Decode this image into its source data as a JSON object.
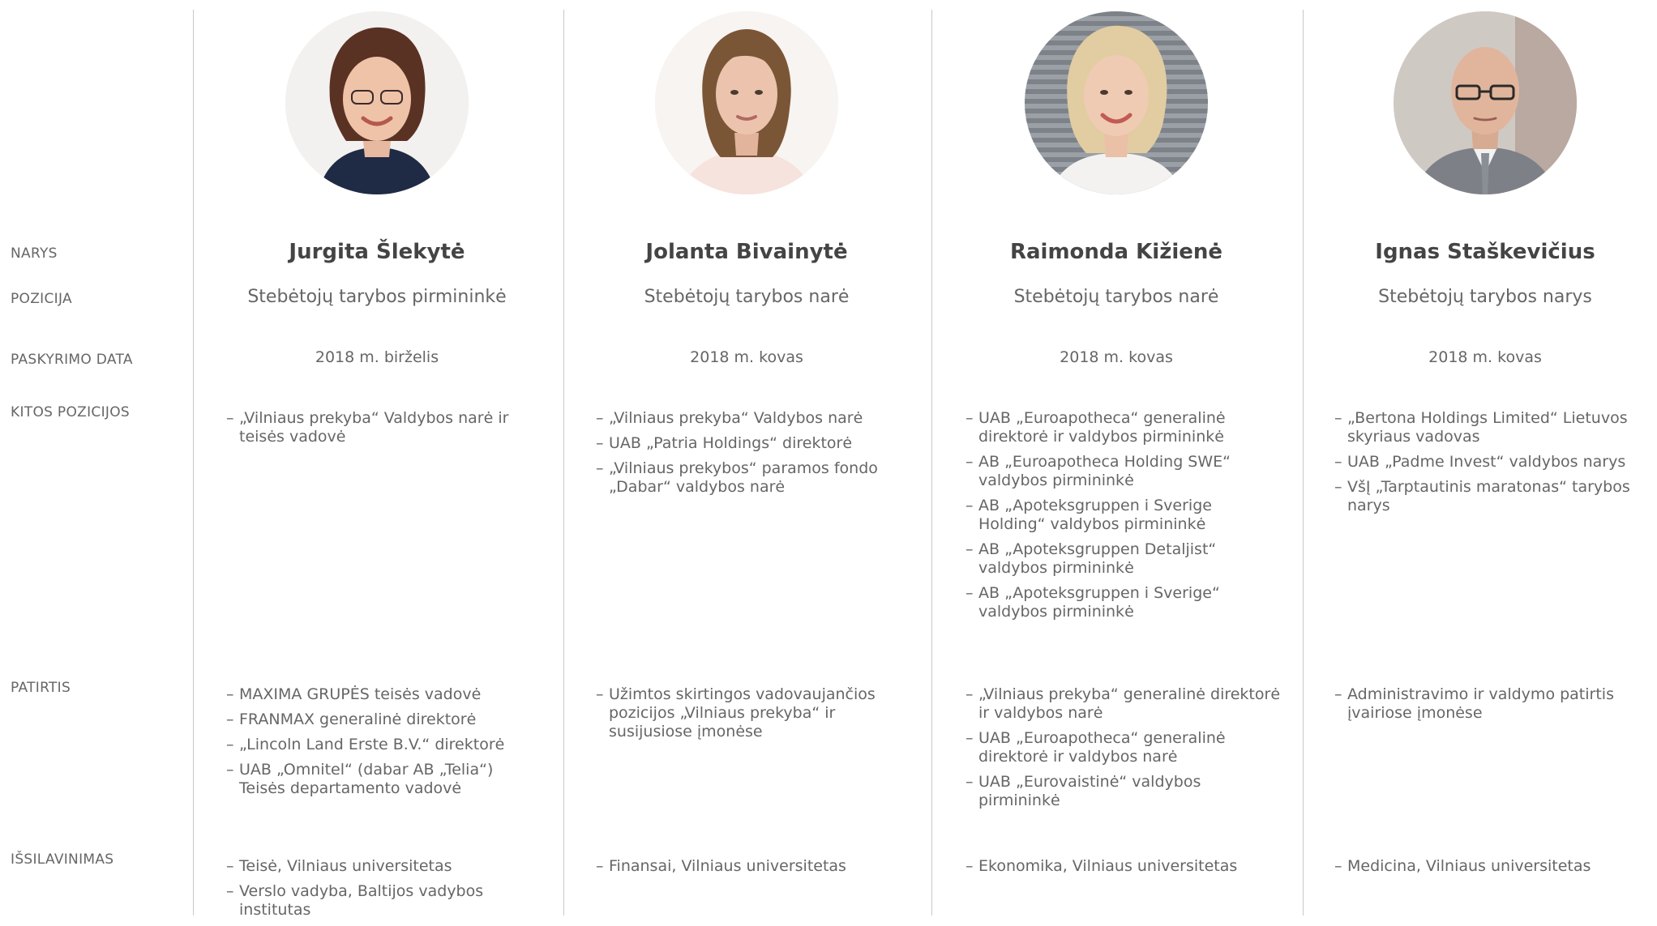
{
  "labels": {
    "member": "NARYS",
    "position": "POZICIJA",
    "appointment_date": "PASKYRIMO DATA",
    "other_positions": "KITOS POZICIJOS",
    "experience": "PATIRTIS",
    "education": "IŠSILAVINIMAS"
  },
  "members": [
    {
      "name": "Jurgita Šlekytė",
      "position": "Stebėtojų tarybos pirmininkė",
      "date": "2018 m. birželis",
      "other_positions": [
        "„Vilniaus prekyba“ Valdybos narė ir teisės vadovė"
      ],
      "experience": [
        "MAXIMA GRUPĖS teisės vadovė",
        "FRANMAX generalinė direktorė",
        "„Lincoln Land Erste B.V.“ direktorė",
        "UAB „Omnitel“ (dabar AB „Telia“) Teisės departamento vadovė"
      ],
      "education": [
        "Teisė, Vilniaus universitetas",
        "Verslo vadyba, Baltijos vadybos institutas"
      ]
    },
    {
      "name": "Jolanta Bivainytė",
      "position": "Stebėtojų tarybos narė",
      "date": "2018 m. kovas",
      "other_positions": [
        "„Vilniaus prekyba“ Valdybos narė",
        "UAB „Patria Holdings“ direktorė",
        "„Vilniaus prekybos“ paramos fondo „Dabar“ valdybos narė"
      ],
      "experience": [
        "Užimtos skirtingos vadovaujančios pozicijos „Vilniaus prekyba“ ir susijusiose įmonėse"
      ],
      "education": [
        "Finansai, Vilniaus universitetas"
      ]
    },
    {
      "name": "Raimonda Kižienė",
      "position": "Stebėtojų tarybos narė",
      "date": "2018 m. kovas",
      "other_positions": [
        "UAB „Euroapotheca“ generalinė direktorė ir valdybos pirmininkė",
        "AB „Euroapotheca Holding SWE“ valdybos pirmininkė",
        "AB „Apoteksgruppen i Sverige Holding“ valdybos pirmininkė",
        "AB „Apoteksgruppen Detaljist“ valdybos pirmininkė",
        "AB „Apoteksgruppen i Sverige“ valdybos pirmininkė"
      ],
      "experience": [
        "„Vilniaus prekyba“ generalinė direktorė ir valdybos narė",
        "UAB „Euroapotheca“ generalinė direktorė ir valdybos narė",
        "UAB „Eurovaistinė“ valdybos pirmininkė"
      ],
      "education": [
        "Ekonomika, Vilniaus universitetas"
      ]
    },
    {
      "name": "Ignas Staškevičius",
      "position": "Stebėtojų tarybos narys",
      "date": "2018 m. kovas",
      "other_positions": [
        "„Bertona Holdings Limited“ Lietuvos skyriaus vadovas",
        "UAB „Padme Invest“ valdybos narys",
        "VšĮ „Tarptautinis maratonas“ tarybos narys"
      ],
      "experience": [
        "Administravimo ir valdymo patirtis įvairiose įmonėse"
      ],
      "education": [
        "Medicina, Vilniaus universitetas"
      ]
    }
  ]
}
